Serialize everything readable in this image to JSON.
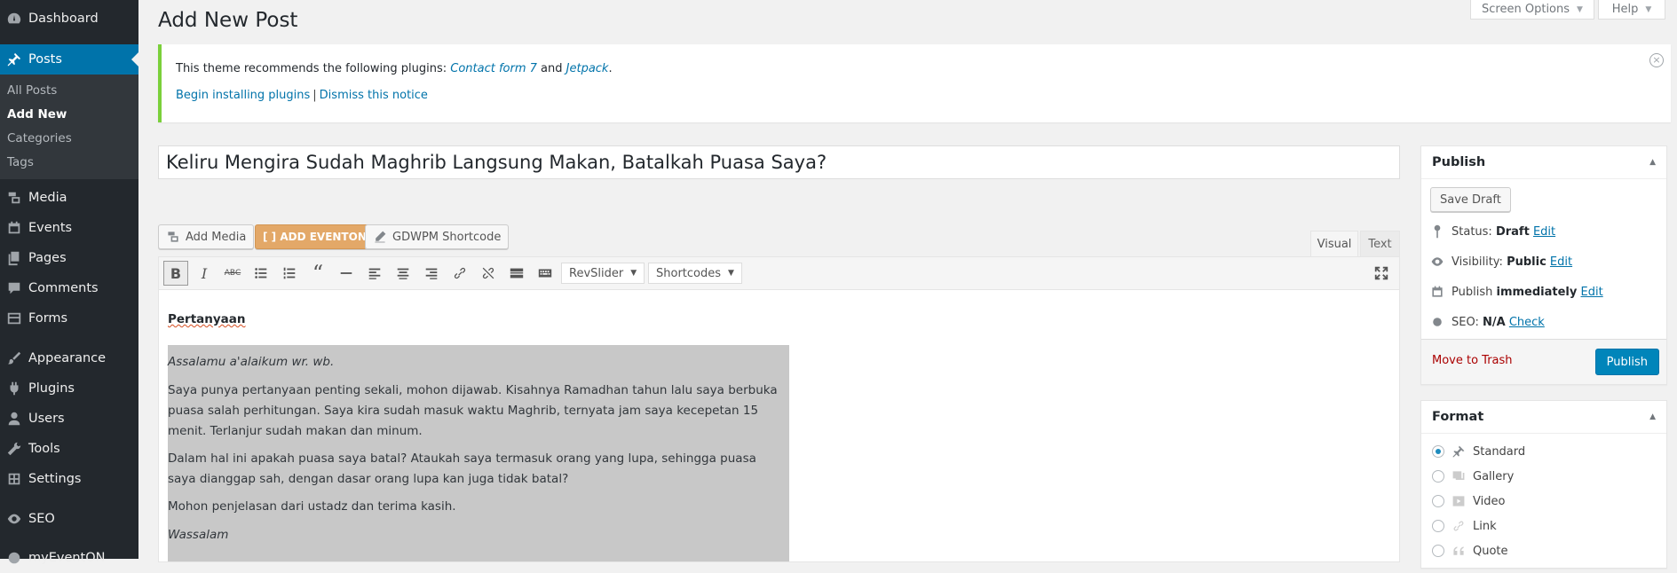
{
  "sidebar": {
    "items": [
      {
        "label": "Dashboard",
        "icon": "dashboard-icon"
      },
      {
        "label": "Posts",
        "icon": "pushpin-icon"
      },
      {
        "label": "Media",
        "icon": "media-icon"
      },
      {
        "label": "Events",
        "icon": "calendar-icon"
      },
      {
        "label": "Pages",
        "icon": "pages-icon"
      },
      {
        "label": "Comments",
        "icon": "comment-icon"
      },
      {
        "label": "Forms",
        "icon": "forms-icon"
      },
      {
        "label": "Appearance",
        "icon": "brush-icon"
      },
      {
        "label": "Plugins",
        "icon": "plugin-icon"
      },
      {
        "label": "Users",
        "icon": "users-icon"
      },
      {
        "label": "Tools",
        "icon": "wrench-icon"
      },
      {
        "label": "Settings",
        "icon": "settings-icon"
      },
      {
        "label": "SEO",
        "icon": "seo-icon"
      },
      {
        "label": "myEventON",
        "icon": "eventon-icon"
      }
    ],
    "submenu": [
      "All Posts",
      "Add New",
      "Categories",
      "Tags"
    ]
  },
  "header": {
    "title": "Add New Post",
    "screen_options": "Screen Options",
    "help": "Help"
  },
  "notice": {
    "text_before": "This theme recommends the following plugins: ",
    "plugin1": "Contact form 7",
    "and": " and ",
    "plugin2": "Jetpack",
    "period": ".",
    "begin": "Begin installing plugins",
    "separator": "|",
    "dismiss": "Dismiss this notice"
  },
  "post_title": "Keliru Mengira Sudah Maghrib Langsung Makan, Batalkah Puasa Saya?",
  "media_buttons": {
    "add_media": "Add Media",
    "eventon": "[ ] ADD EVENTON",
    "gdwpm": "GDWPM Shortcode"
  },
  "editor_tabs": {
    "visual": "Visual",
    "text": "Text"
  },
  "toolbar": {
    "revslider": "RevSlider",
    "shortcodes": "Shortcodes"
  },
  "content": {
    "heading": "Pertanyaan",
    "p1": "Assalamu a'alaikum wr. wb.",
    "p2": "Saya punya pertanyaan penting sekali, mohon dijawab. Kisahnya Ramadhan tahun lalu saya berbuka puasa salah perhitungan. Saya kira sudah masuk waktu Maghrib, ternyata jam saya kecepetan 15 menit. Terlanjur sudah makan dan minum.",
    "p3": "Dalam hal ini apakah puasa saya batal? Ataukah saya termasuk orang yang lupa, sehingga puasa saya dianggap sah, dengan dasar orang lupa kan juga tidak batal?",
    "p4": "Mohon penjelasan dari ustadz dan terima kasih.",
    "p5": "Wassalam"
  },
  "publish": {
    "title": "Publish",
    "save_draft": "Save Draft",
    "status_label": "Status:",
    "status_value": "Draft",
    "visibility_label": "Visibility:",
    "visibility_value": "Public",
    "publish_label": "Publish",
    "publish_value": "immediately",
    "seo_label": "SEO:",
    "seo_value": "N/A",
    "seo_link": "Check",
    "edit": "Edit",
    "move_to_trash": "Move to Trash",
    "publish_button": "Publish"
  },
  "format": {
    "title": "Format",
    "options": [
      "Standard",
      "Gallery",
      "Video",
      "Link",
      "Quote"
    ],
    "selected": "Standard"
  }
}
